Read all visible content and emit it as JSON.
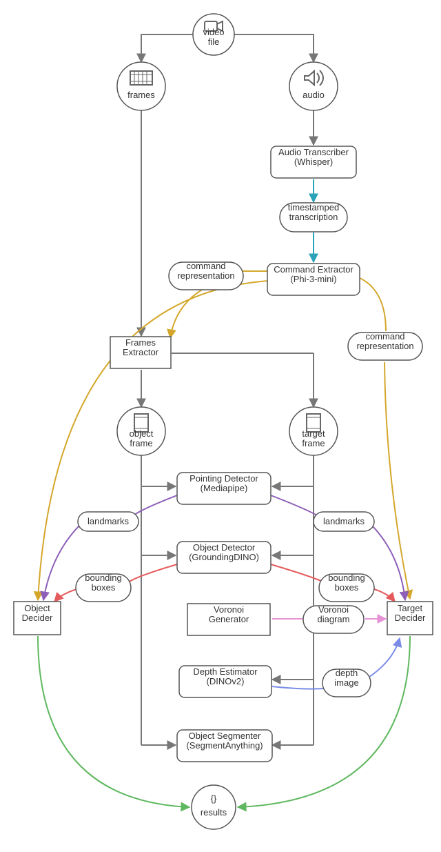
{
  "nodes": {
    "video_file": "video\nfile",
    "frames": "frames",
    "audio": "audio",
    "audio_transcriber": "Audio Transcriber\n(Whisper)",
    "timestamped": "timestamped\ntranscription",
    "command_extractor": "Command Extractor\n(Phi-3-mini)",
    "command_rep1": "command\nrepresentation",
    "command_rep2": "command\nrepresentation",
    "frames_extractor": "Frames\nExtractor",
    "object_frame": "object\nframe",
    "target_frame": "target\nframe",
    "pointing_detector": "Pointing Detector\n(Mediapipe)",
    "landmarks_l": "landmarks",
    "landmarks_r": "landmarks",
    "object_detector": "Object Detector\n(GroundingDINO)",
    "bbox_l": "bounding\nboxes",
    "bbox_r": "bounding\nboxes",
    "object_decider": "Object\nDecider",
    "target_decider": "Target\nDecider",
    "voronoi_gen": "Voronoi\nGenerator",
    "voronoi_diag": "Voronoi\ndiagram",
    "depth_est": "Depth Estimator\n(DINOv2)",
    "depth_img": "depth\nimage",
    "object_seg": "Object Segmenter\n(SegmentAnything)",
    "results": "results"
  },
  "colors": {
    "gray": "#777",
    "teal": "#2aa3b8",
    "gold": "#d4a72c",
    "purple": "#8e5fb9",
    "red": "#e55b5b",
    "blue": "#7a8ce8",
    "pink": "#e693d6",
    "green": "#5fb85f"
  }
}
